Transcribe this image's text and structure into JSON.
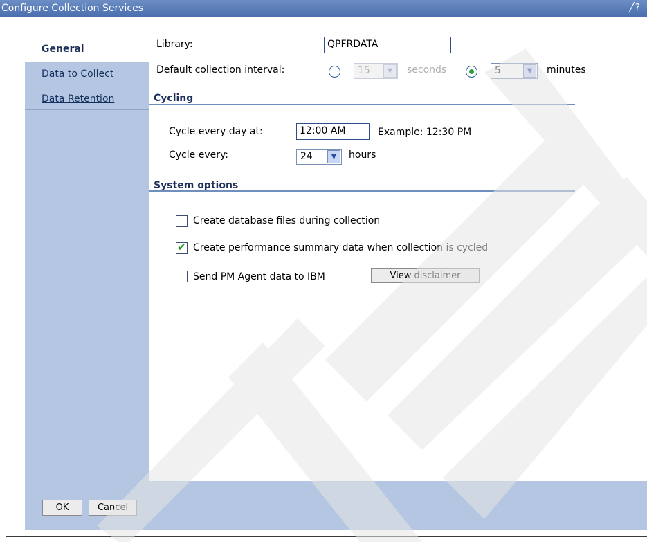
{
  "window": {
    "title": "Configure Collection Services",
    "controls": "╱?–□"
  },
  "nav": {
    "items": [
      {
        "label": "General"
      },
      {
        "label": "Data to Collect"
      },
      {
        "label": "Data Retention"
      }
    ]
  },
  "general": {
    "library_label": "Library:",
    "library_value": "QPFRDATA",
    "interval_label": "Default collection interval:",
    "seconds_value": "15",
    "seconds_unit": "seconds",
    "minutes_value": "5",
    "minutes_unit": "minutes",
    "selected_interval": "minutes"
  },
  "cycling": {
    "title": "Cycling",
    "cycle_day_label": "Cycle every day at:",
    "cycle_day_value": "12:00 AM",
    "example": "Example: 12:30 PM",
    "cycle_every_label": "Cycle every:",
    "cycle_every_value": "24",
    "cycle_every_unit": "hours"
  },
  "system_options": {
    "title": "System options",
    "options": [
      {
        "label": "Create database files during collection",
        "checked": false
      },
      {
        "label": "Create performance summary data when collection is cycled",
        "checked": true
      },
      {
        "label": "Send PM Agent data to IBM",
        "checked": false
      }
    ],
    "view_disclaimer": "View disclaimer"
  },
  "footer": {
    "ok": "OK",
    "cancel": "Cancel"
  },
  "icons": {
    "dropdown": "chevron-down-icon",
    "check": "checkmark-icon"
  },
  "colors": {
    "titlebar": "#4a6fae",
    "sidebar": "#b4c6e1",
    "accent": "#6f8fbf",
    "check": "#1e8a1e"
  }
}
